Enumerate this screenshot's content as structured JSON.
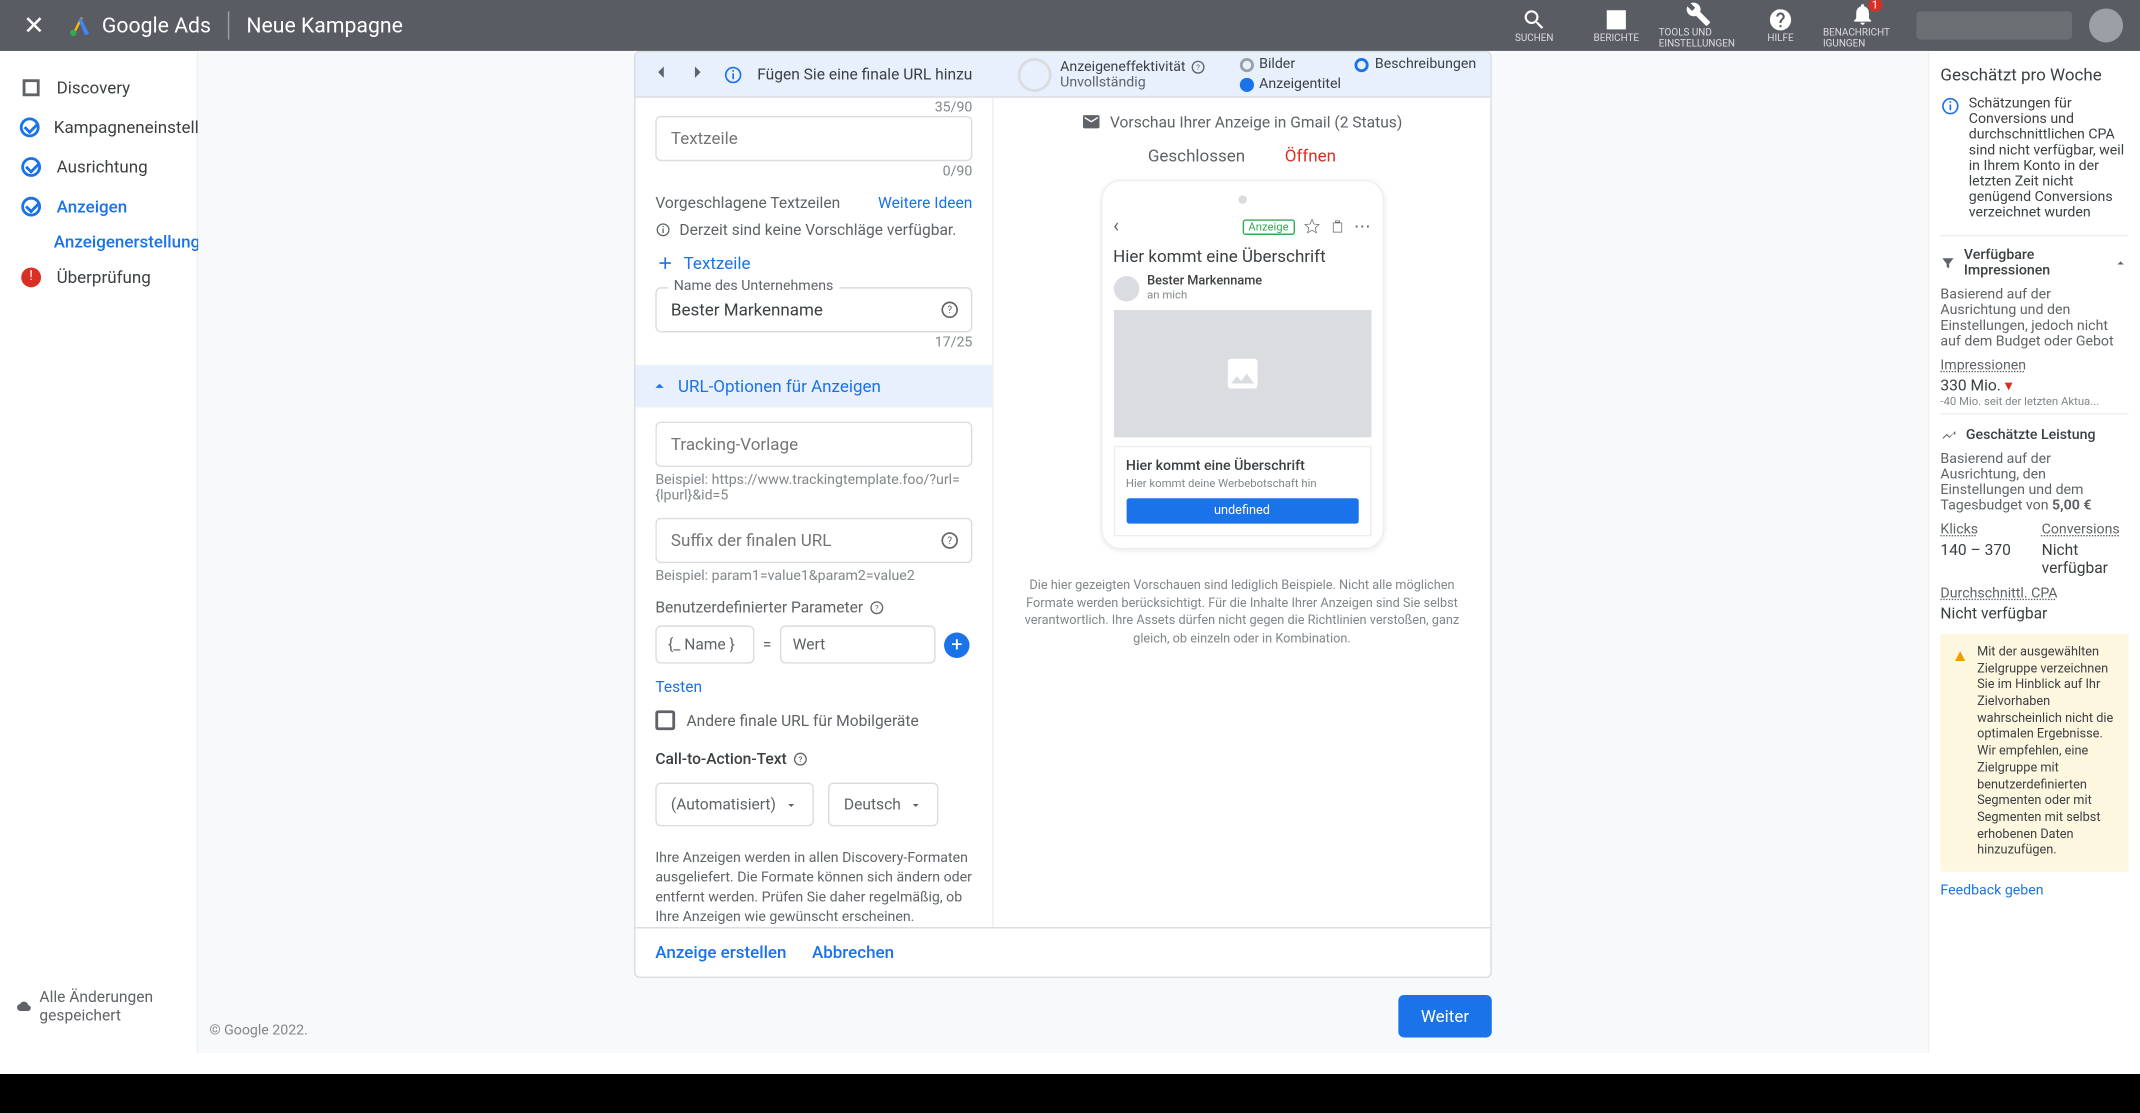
{
  "topbar": {
    "product": "Google Ads",
    "page": "Neue Kampagne",
    "items": [
      {
        "id": "search",
        "label": "SUCHEN"
      },
      {
        "id": "reports",
        "label": "BERICHTE"
      },
      {
        "id": "tools",
        "label": "TOOLS UND EINSTELLUNGEN"
      },
      {
        "id": "help",
        "label": "HILFE"
      },
      {
        "id": "notif",
        "label": "BENACHRICHT IGUNGEN",
        "badge": "1"
      }
    ]
  },
  "leftnav": {
    "items": [
      {
        "label": "Discovery",
        "type": "sq"
      },
      {
        "label": "Kampagneneinstellungen",
        "type": "chk"
      },
      {
        "label": "Ausrichtung",
        "type": "chk"
      },
      {
        "label": "Anzeigen",
        "type": "chk",
        "active": true
      },
      {
        "label": "Überprüfung",
        "type": "warn"
      }
    ],
    "sub": "Anzeigenerstellung",
    "saved": "Alle Änderungen gespeichert"
  },
  "copyright": "© Google 2022.",
  "cardHead": {
    "hint": "Fügen Sie eine finale URL hinzu",
    "eff": "Anzeigeneffektivität",
    "effv": "Unvollständig",
    "pills": {
      "a": "Bilder",
      "b": "Beschreibungen",
      "c": "Anzeigentitel"
    }
  },
  "form": {
    "cnt1": "35/90",
    "ph_textzeile": "Textzeile",
    "cnt2": "0/90",
    "sug_lbl": "Vorgeschlagene Textzeilen",
    "sug_more": "Weitere Ideen",
    "sug_none": "Derzeit sind keine Vorschläge verfügbar.",
    "add_line": "Textzeile",
    "biz_lbl": "Name des Unternehmens",
    "biz_val": "Bester Markenname",
    "biz_cnt": "17/25",
    "url_sect": "URL-Optionen für Anzeigen",
    "track_ph": "Tracking-Vorlage",
    "track_ex": "Beispiel: https://www.trackingtemplate.foo/?url={lpurl}&id=5",
    "suffix_ph": "Suffix der finalen URL",
    "suffix_ex": "Beispiel: param1=value1&param2=value2",
    "param_lbl": "Benutzerdefinierter Parameter",
    "param_name": "{_ Name       }",
    "param_eq": "=",
    "param_val": "Wert",
    "test": "Testen",
    "mobile_chk": "Andere finale URL für Mobilgeräte",
    "cta_sect": "Call-to-Action-Text",
    "cta_dd": "(Automatisiert)",
    "lang_dd": "Deutsch",
    "note": "Ihre Anzeigen werden in allen Discovery-Formaten ausgeliefert. Die Formate können sich ändern oder entfernt werden. Prüfen Sie daher regelmäßig, ob Ihre Anzeigen wie gewünscht erscheinen.",
    "create": "Anzeige erstellen",
    "cancel": "Abbrechen"
  },
  "weiter": "Weiter",
  "preview": {
    "hdr": "Vorschau Ihrer Anzeige in Gmail (2 Status)",
    "tab1": "Geschlossen",
    "tab2": "Öffnen",
    "tag": "Anzeige",
    "h": "Hier kommt eine Überschrift",
    "from": "Bester Markenname",
    "to": "an mich",
    "ch": "Hier kommt eine Überschrift",
    "cb": "Hier kommt deine Werbebotschaft hin",
    "cta": "undefined",
    "disc": "Die hier gezeigten Vorschauen sind lediglich Beispiele. Nicht alle möglichen Formate werden berücksichtigt. Für die Inhalte Ihrer Anzeigen sind Sie selbst verantwortlich. Ihre Assets dürfen nicht gegen die Richtlinien verstoßen, ganz gleich, ob einzeln oder in Kombination."
  },
  "right": {
    "ttl": "Geschätzt pro Woche",
    "est": "Schätzungen für Conversions und durchschnittlichen CPA sind nicht verfügbar, weil in Ihrem Konto in der letzten Zeit nicht genügend Conversions verzeichnet wurden",
    "imp_t": "Verfügbare Impressionen",
    "imp_b": "Basierend auf der Ausrichtung und den Einstellungen, jedoch nicht auf dem Budget oder Gebot",
    "imp_l": "Impressionen",
    "imp_v": "330 Mio. ",
    "imp_s": "-40 Mio. seit der letzten Aktua...",
    "perf_t": "Geschätzte Leistung",
    "perf_b": "Basierend auf der Ausrichtung, den Einstellungen und dem Tagesbudget von ",
    "perf_bv": "5,00 €",
    "klicks_l": "Klicks",
    "klicks_v": "140 – 370",
    "conv_l": "Conversions",
    "conv_v": "Nicht verfügbar",
    "cpa_l": "Durchschnittl. CPA",
    "cpa_v": "Nicht verfügbar",
    "warn": "Mit der ausgewählten Zielgruppe verzeichnen Sie im Hinblick auf Ihr Zielvorhaben wahrscheinlich nicht die optimalen Ergebnisse. Wir empfehlen, eine Zielgruppe mit benutzerdefinierten Segmenten oder mit Segmenten mit selbst erhobenen Daten hinzuzufügen.",
    "fb": "Feedback geben"
  }
}
